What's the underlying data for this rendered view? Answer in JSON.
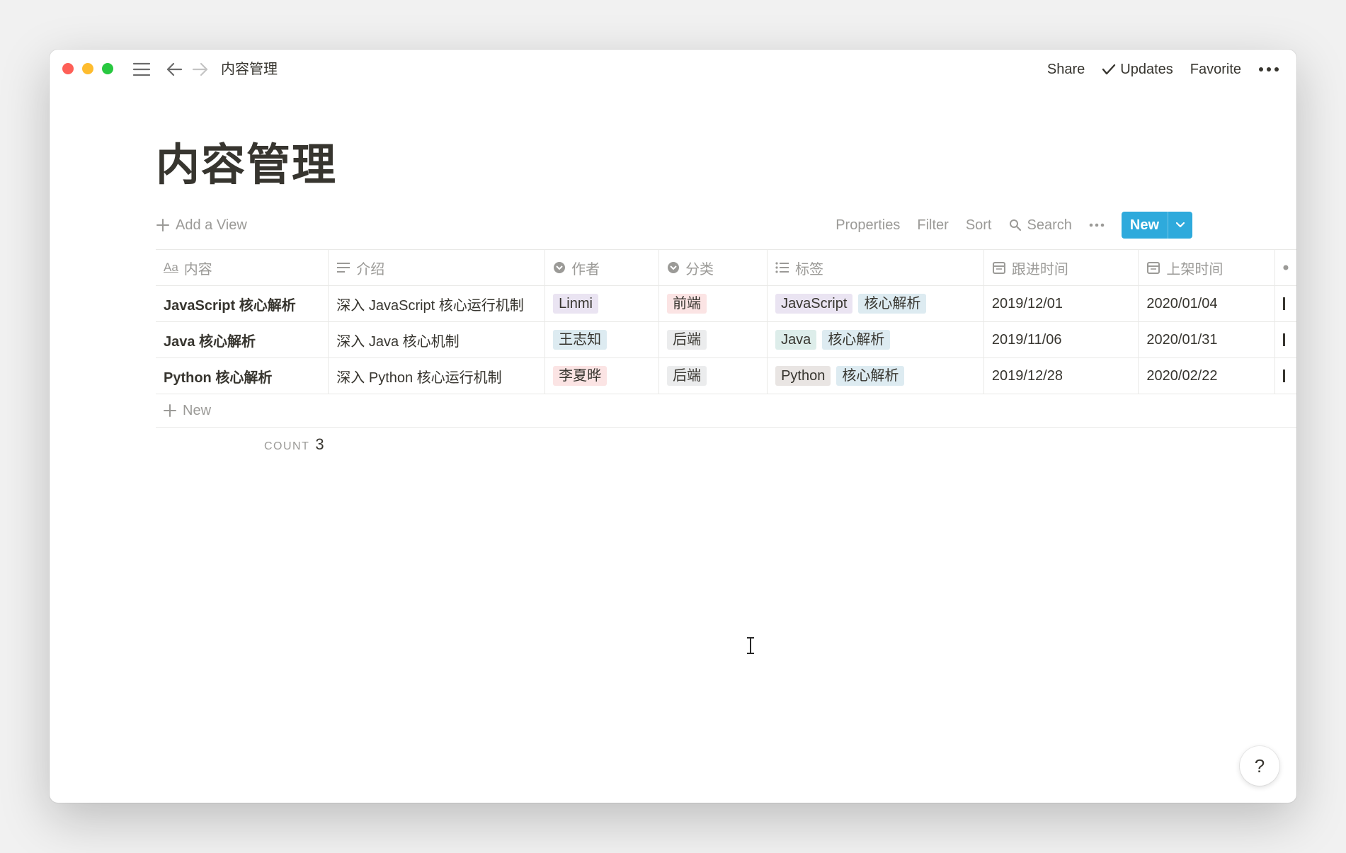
{
  "titlebar": {
    "breadcrumb": "内容管理",
    "share": "Share",
    "updates": "Updates",
    "favorite": "Favorite"
  },
  "page": {
    "title": "内容管理"
  },
  "viewbar": {
    "add_view": "Add a View",
    "properties": "Properties",
    "filter": "Filter",
    "sort": "Sort",
    "search": "Search",
    "new_button": "New"
  },
  "table": {
    "headers": [
      "内容",
      "介绍",
      "作者",
      "分类",
      "标签",
      "跟进时间",
      "上架时间"
    ],
    "header_icons": [
      "text-icon",
      "lines-icon",
      "select-icon",
      "select-icon",
      "list-icon",
      "calendar-icon",
      "calendar-icon"
    ],
    "rows": [
      {
        "title": "JavaScript 核心解析",
        "intro": "深入 JavaScript 核心运行机制",
        "author": "Linmi",
        "category": "前端",
        "tags": [
          "JavaScript",
          "核心解析"
        ],
        "follow_date": "2019/12/01",
        "publish_date": "2020/01/04"
      },
      {
        "title": "Java 核心解析",
        "intro": "深入 Java 核心机制",
        "author": "王志知",
        "category": "后端",
        "tags": [
          "Java",
          "核心解析"
        ],
        "follow_date": "2019/11/06",
        "publish_date": "2020/01/31"
      },
      {
        "title": "Python 核心解析",
        "intro": "深入 Python 核心运行机制",
        "author": "李夏晔",
        "category": "后端",
        "tags": [
          "Python",
          "核心解析"
        ],
        "follow_date": "2019/12/28",
        "publish_date": "2020/02/22"
      }
    ],
    "new_row": "New",
    "count_label": "COUNT",
    "count_value": "3"
  },
  "help": "?",
  "colors": {
    "accent": "#2eaadc",
    "tag_purple": "#eae4f2",
    "tag_red": "#fbe4e4",
    "tag_gray": "#ebeced",
    "tag_blue": "#ddebf1",
    "tag_teal": "#ddedea",
    "tag_brown": "#e9e5e3"
  }
}
